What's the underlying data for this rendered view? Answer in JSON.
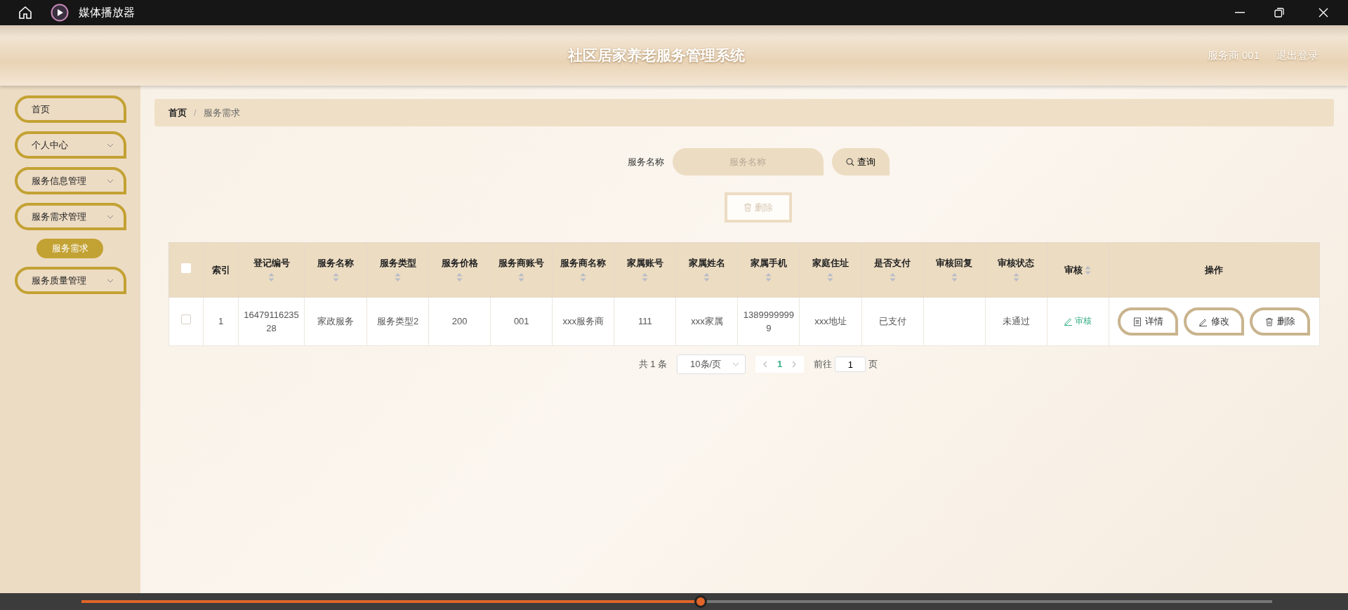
{
  "window": {
    "title": "媒体播放器"
  },
  "header": {
    "title": "社区居家养老服务管理系统",
    "user": "服务商 001",
    "logout": "退出登录"
  },
  "sidebar": {
    "items": [
      {
        "label": "首页",
        "kind": "link"
      },
      {
        "label": "个人中心",
        "kind": "menu"
      },
      {
        "label": "服务信息管理",
        "kind": "menu"
      },
      {
        "label": "服务需求管理",
        "kind": "menu",
        "children": [
          {
            "label": "服务需求",
            "selected": true
          }
        ]
      },
      {
        "label": "服务质量管理",
        "kind": "menu"
      }
    ]
  },
  "breadcrumb": {
    "separator": "/",
    "items": [
      "首页",
      "服务需求"
    ]
  },
  "search": {
    "label": "服务名称",
    "placeholder": "服务名称",
    "button": "查询"
  },
  "toolbar": {
    "delete": {
      "label": "删除",
      "disabled": true
    }
  },
  "table": {
    "header_checked": false,
    "columns": [
      {
        "label": "索引",
        "sortable": false
      },
      {
        "label": "登记编号",
        "sortable": true
      },
      {
        "label": "服务名称",
        "sortable": true
      },
      {
        "label": "服务类型",
        "sortable": true
      },
      {
        "label": "服务价格",
        "sortable": true
      },
      {
        "label": "服务商账号",
        "sortable": true
      },
      {
        "label": "服务商名称",
        "sortable": true
      },
      {
        "label": "家属账号",
        "sortable": true
      },
      {
        "label": "家属姓名",
        "sortable": true
      },
      {
        "label": "家属手机",
        "sortable": true
      },
      {
        "label": "家庭住址",
        "sortable": true
      },
      {
        "label": "是否支付",
        "sortable": true
      },
      {
        "label": "审核回复",
        "sortable": true
      },
      {
        "label": "审核状态",
        "sortable": true
      },
      {
        "label": "审核",
        "sortable": true
      },
      {
        "label": "操作",
        "sortable": false
      }
    ],
    "rows": [
      {
        "checked": false,
        "cells": [
          "1",
          "1647911623528",
          "家政服务",
          "服务类型2",
          "200",
          "001",
          "xxx服务商",
          "111",
          "xxx家属",
          "13899999999",
          "xxx地址",
          "已支付",
          null,
          "未通过"
        ],
        "audit": "审核",
        "actions": [
          {
            "label": "详情",
            "kind": "detail"
          },
          {
            "label": "修改",
            "kind": "edit"
          },
          {
            "label": "删除",
            "kind": "delete"
          }
        ]
      }
    ]
  },
  "pagination": {
    "total": "共 1 条",
    "page_size": "10条/页",
    "pages": [
      {
        "label": "1",
        "selected": true
      }
    ],
    "goto_label": "前往",
    "goto_value": "1",
    "page_suffix": "页"
  },
  "player": {
    "level": 0.52
  }
}
